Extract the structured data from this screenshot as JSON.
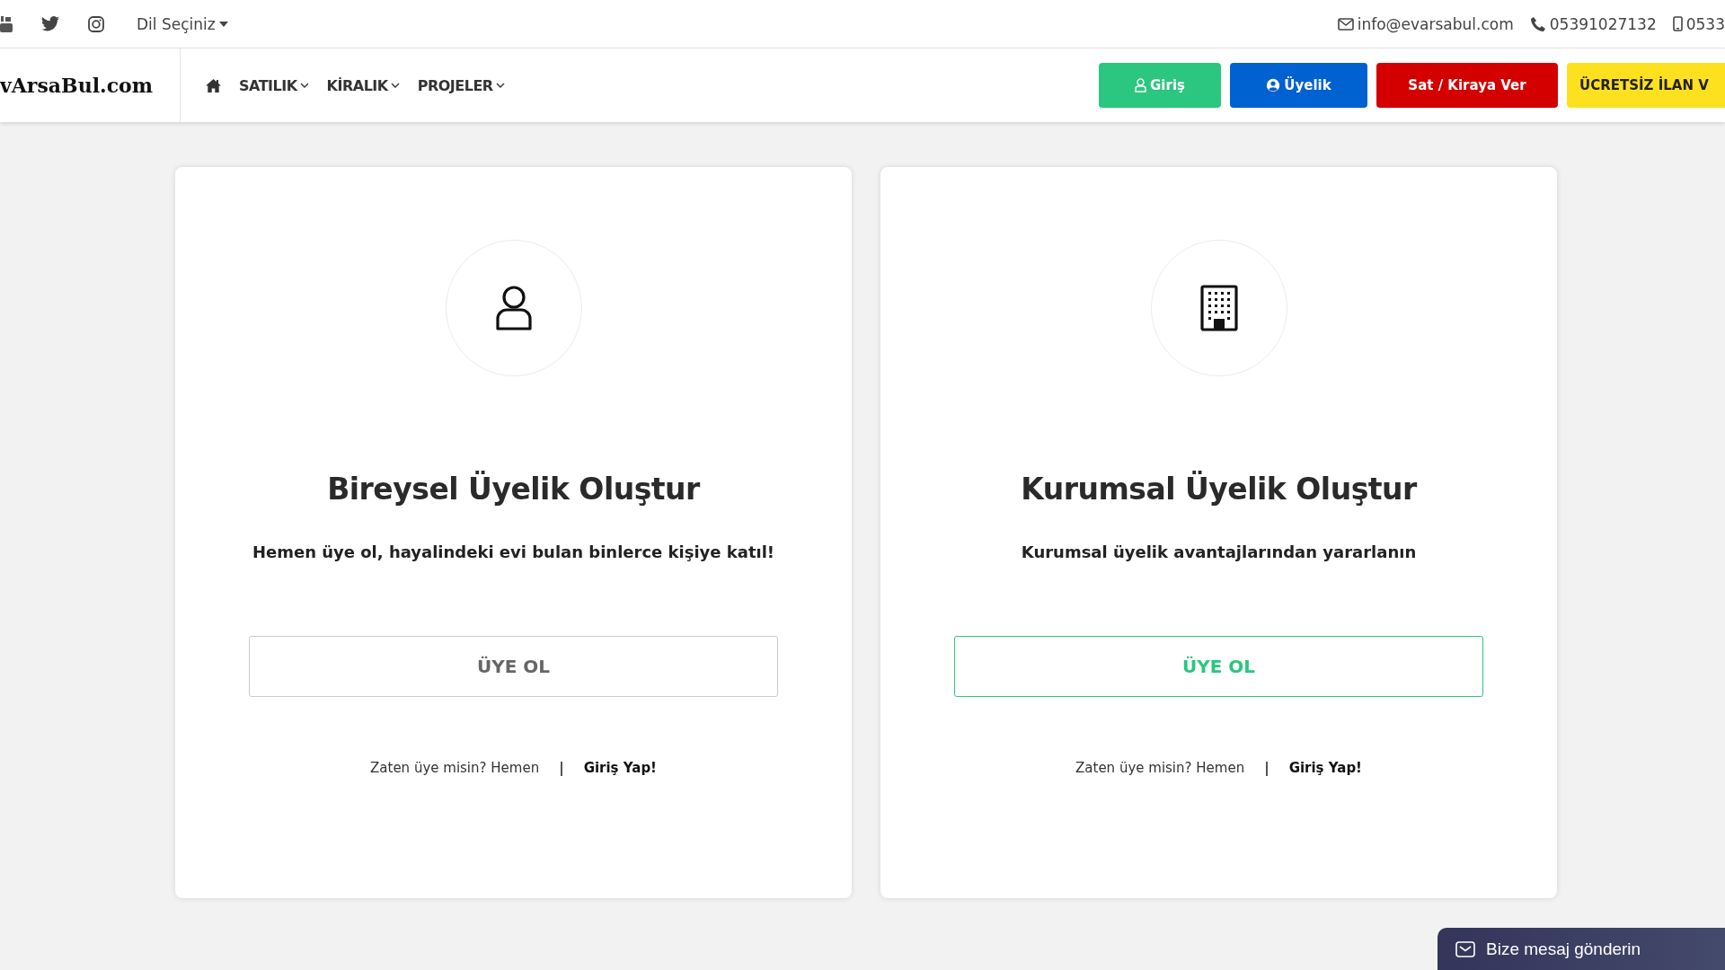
{
  "top_bar": {
    "language": "Dil Seçiniz",
    "email": "info@evarsabul.com",
    "phone": "05391027132",
    "mobile": "0533"
  },
  "nav": {
    "logo": "vArsaBul.com",
    "menu": [
      {
        "label": "SATILIK"
      },
      {
        "label": "KİRALIK"
      },
      {
        "label": "PROJELER"
      }
    ],
    "buttons": [
      {
        "label": "Giriş",
        "kind": "login"
      },
      {
        "label": "Üyelik",
        "kind": "member"
      },
      {
        "label": "Sat / Kiraya Ver",
        "kind": "sell"
      },
      {
        "label": "ÜCRETSİZ İLAN V",
        "kind": "free"
      }
    ]
  },
  "cards": [
    {
      "kind": "person",
      "title": "Bireysel Üyelik Oluştur",
      "subtitle": "Hemen üye ol, hayalindeki evi bulan binlerce kişiye katıl!",
      "button": "ÜYE OL",
      "selected": false,
      "prompt": "Zaten üye misin? Hemen",
      "separator": "|",
      "link": "Giriş Yap!"
    },
    {
      "kind": "company",
      "title": "Kurumsal Üyelik Oluştur",
      "subtitle": "Kurumsal üyelik avantajlarından yararlanın",
      "button": "ÜYE OL",
      "selected": true,
      "prompt": "Zaten üye misin? Hemen",
      "separator": "|",
      "link": "Giriş Yap!"
    }
  ],
  "chat_widget": {
    "label": "Bize mesaj gönderin"
  }
}
